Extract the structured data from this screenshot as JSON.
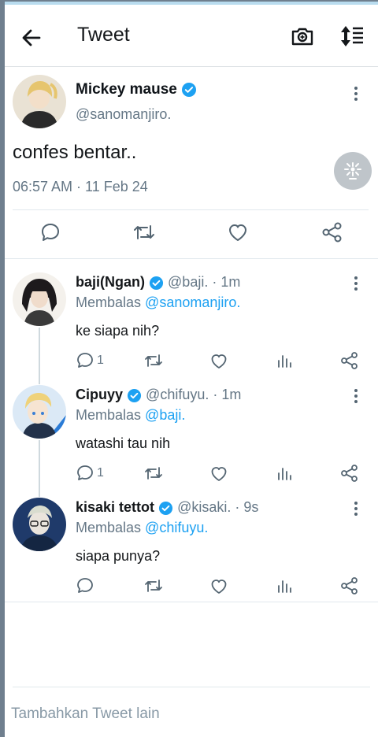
{
  "header": {
    "title": "Tweet"
  },
  "main_tweet": {
    "name": "Mickey mause",
    "handle": "@sanomanjiro.",
    "text": "confes bentar..",
    "timestamp": "06:57 AM · 11 Feb 24"
  },
  "replies": [
    {
      "name": "baji(Ngan)",
      "handle": "@baji.",
      "time": "· 1m",
      "replying_prefix": "Membalas",
      "replying_to": "@sanomanjiro.",
      "text": "ke siapa nih?",
      "reply_count": "1"
    },
    {
      "name": "Cipuyy",
      "handle": "@chifuyu.",
      "time": "· 1m",
      "replying_prefix": "Membalas",
      "replying_to": "@baji.",
      "text": "watashi tau nih",
      "reply_count": "1"
    },
    {
      "name": "kisaki tettot",
      "handle": "@kisaki.",
      "time": "· 9s",
      "replying_prefix": "Membalas",
      "replying_to": "@chifuyu.",
      "text": "siapa punya?",
      "reply_count": ""
    }
  ],
  "compose": {
    "placeholder": "Tambahkan Tweet lain"
  },
  "colors": {
    "accent": "#1da1f2",
    "muted": "#657786",
    "divider": "#e1e8ed"
  }
}
